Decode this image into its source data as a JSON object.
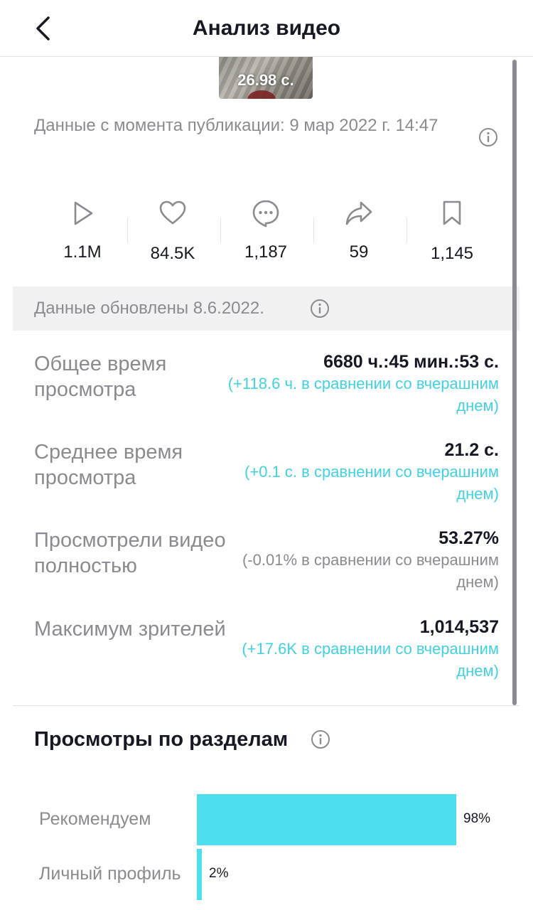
{
  "header": {
    "title": "Анализ видео",
    "back_icon": "chevron-left-icon"
  },
  "video": {
    "duration": "26.98 с."
  },
  "publication": {
    "text": "Данные с момента публикации: 9 мар 2022 г. 14:47"
  },
  "stats": [
    {
      "icon": "play-icon",
      "value": "1.1M"
    },
    {
      "icon": "heart-icon",
      "value": "84.5K"
    },
    {
      "icon": "comment-icon",
      "value": "1,187"
    },
    {
      "icon": "share-icon",
      "value": "59"
    },
    {
      "icon": "bookmark-icon",
      "value": "1,145"
    }
  ],
  "updated": {
    "text": "Данные обновлены 8.6.2022."
  },
  "metrics": [
    {
      "label": "Общее время просмотра",
      "value": "6680 ч.:45 мин.:53 с.",
      "delta": "(+118.6 ч. в сравнении со вчерашним днем)",
      "delta_color": "#41d1e3"
    },
    {
      "label": "Среднее время просмотра",
      "value": "21.2 с.",
      "delta": "(+0.1 с. в сравнении со вчерашним днем)",
      "delta_color": "#41d1e3"
    },
    {
      "label": "Просмотрели видео полностью",
      "value": "53.27%",
      "delta": "(-0.01% в сравнении со вчерашним днем)",
      "delta_color": "#8a8b91"
    },
    {
      "label": "Максимум зрителей",
      "value": "1,014,537",
      "delta": "(+17.6K в сравнении со вчерашним днем)",
      "delta_color": "#41d1e3"
    }
  ],
  "sections": {
    "title": "Просмотры по разделам",
    "items": [
      {
        "label": "Рекомендуем",
        "percent": "98%",
        "share": 0.98
      },
      {
        "label": "Личный профиль",
        "percent": "2%",
        "share": 0.02
      }
    ]
  },
  "colors": {
    "accent": "#41d1e3",
    "bar": "#4ddfef",
    "text_primary": "#161823",
    "text_secondary": "#8a8b91"
  }
}
